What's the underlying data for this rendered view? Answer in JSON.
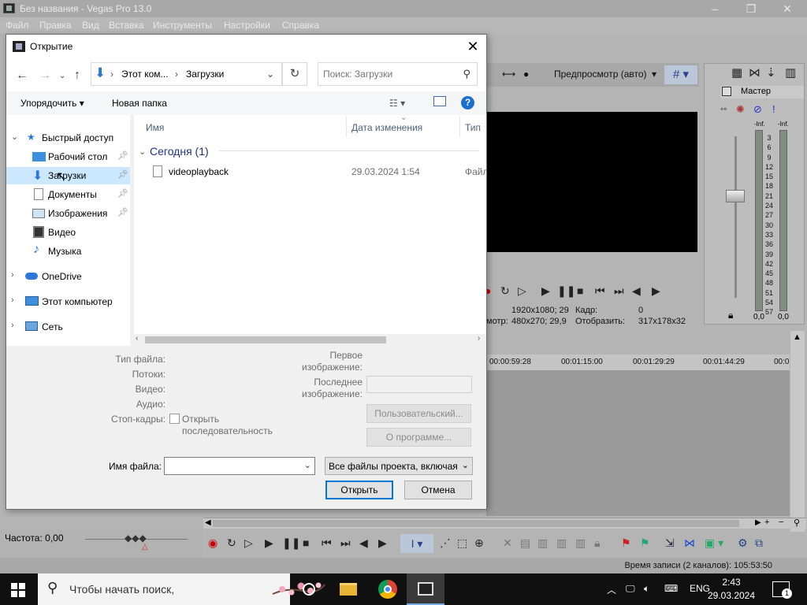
{
  "app": {
    "title": "Без названия - Vegas Pro 13.0",
    "window_buttons": [
      "‒",
      "❐",
      "✕"
    ],
    "menu": [
      "Файл",
      "Правка",
      "Вид",
      "Вставка",
      "Инструменты",
      "Настройки",
      "Справка"
    ],
    "preview": {
      "quality": "Предпросмотр (авто)",
      "project_res": "1920x1080; 29",
      "preview_res_label": "мотр:",
      "preview_res": "480x270; 29,9",
      "frame_label": "Кадр:",
      "frame_value": "0",
      "display_label": "Отобразить:",
      "display_value": "317x178x32"
    },
    "master": {
      "label": "Мастер",
      "peak_left": "-Inf.",
      "peak_right": "-Inf.",
      "scale": [
        "3",
        "6",
        "9",
        "12",
        "15",
        "18",
        "21",
        "24",
        "27",
        "30",
        "33",
        "36",
        "39",
        "42",
        "45",
        "48",
        "51",
        "54",
        "57"
      ],
      "value_left": "0,0",
      "value_right": "0,0"
    },
    "timeline": {
      "ruler": [
        "00:00:59:28",
        "00:01:15:00",
        "00:01:29:29",
        "00:01:44:29",
        "00:0"
      ]
    },
    "rate": "Частота: 0,00",
    "status": "Время записи (2 каналов): 105:53:50"
  },
  "dialog": {
    "title": "Открытие",
    "close": "✕",
    "breadcrumb": [
      "Этот ком...",
      "Загрузки"
    ],
    "search_placeholder": "Поиск: Загрузки",
    "organize": "Упорядочить ▾",
    "new_folder": "Новая папка",
    "nav": {
      "quick_access": "Быстрый доступ",
      "desktop": "Рабочий стол",
      "downloads": "Загрузки",
      "documents": "Документы",
      "pictures": "Изображения",
      "video": "Видео",
      "music": "Музыка",
      "onedrive": "OneDrive",
      "this_pc": "Этот компьютер",
      "network": "Сеть"
    },
    "columns": {
      "name": "Имя",
      "modified": "Дата изменения",
      "type": "Тип"
    },
    "group": "Сегодня (1)",
    "files": [
      {
        "name": "videoplayback",
        "modified": "29.03.2024 1:54",
        "type": "Файл"
      }
    ],
    "props": {
      "file_type": "Тип файла:",
      "streams": "Потоки:",
      "video": "Видео:",
      "audio": "Аудио:",
      "stills": "Стоп-кадры:",
      "open_sequence": "Открыть последовательность",
      "first_image_1": "Первое",
      "first_image_2": "изображение:",
      "last_image_1": "Последнее",
      "last_image_2": "изображение:",
      "custom": "Пользовательский...",
      "about": "О программе..."
    },
    "filename_label": "Имя файла:",
    "filename_value": "",
    "filter": "Все файлы проекта, включая",
    "open": "Открыть",
    "cancel": "Отмена"
  },
  "taskbar": {
    "search_placeholder": "Чтобы начать поиск,",
    "lang": "ENG",
    "time": "2:43",
    "date": "29.03.2024",
    "notifications": "1"
  }
}
